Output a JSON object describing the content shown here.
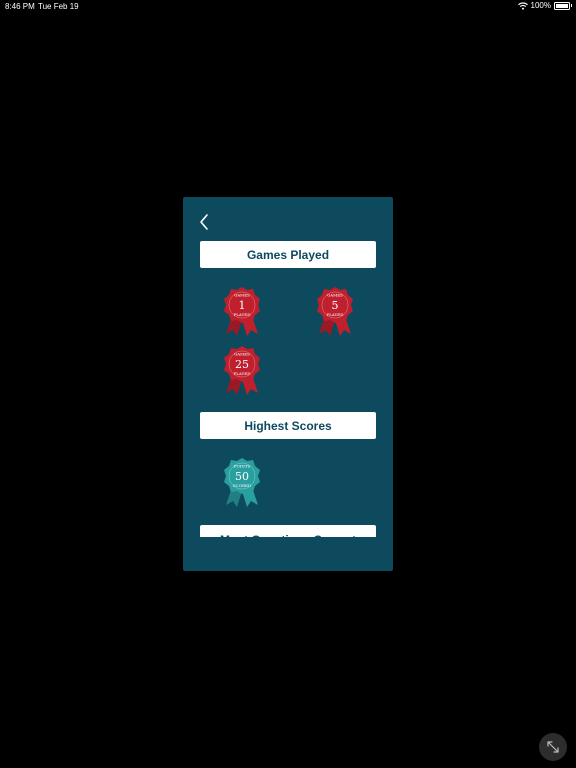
{
  "status_bar": {
    "time": "8:46 PM",
    "date": "Tue Feb 19",
    "battery": "100%"
  },
  "sections": [
    {
      "title": "Games Played",
      "badges": [
        {
          "top": "GAMES",
          "number": "1",
          "bottom": "PLAYED",
          "color": "#c0202e"
        },
        {
          "top": "GAMES",
          "number": "5",
          "bottom": "PLAYED",
          "color": "#c0202e"
        },
        {
          "top": "GAMES",
          "number": "25",
          "bottom": "PLAYED",
          "color": "#c0202e"
        }
      ]
    },
    {
      "title": "Highest Scores",
      "badges": [
        {
          "top": "POINTS",
          "number": "50",
          "bottom": "SCORED",
          "color": "#2a9fa0"
        }
      ]
    },
    {
      "title": "Most Questions Correct"
    }
  ],
  "colors": {
    "panel": "#0d4a5e",
    "red_badge": "#c0202e",
    "teal_badge": "#2a9fa0"
  },
  "icons": {
    "back": "chevron-left-icon",
    "expand": "expand-arrows-icon",
    "wifi": "wifi-icon",
    "battery": "battery-icon"
  }
}
